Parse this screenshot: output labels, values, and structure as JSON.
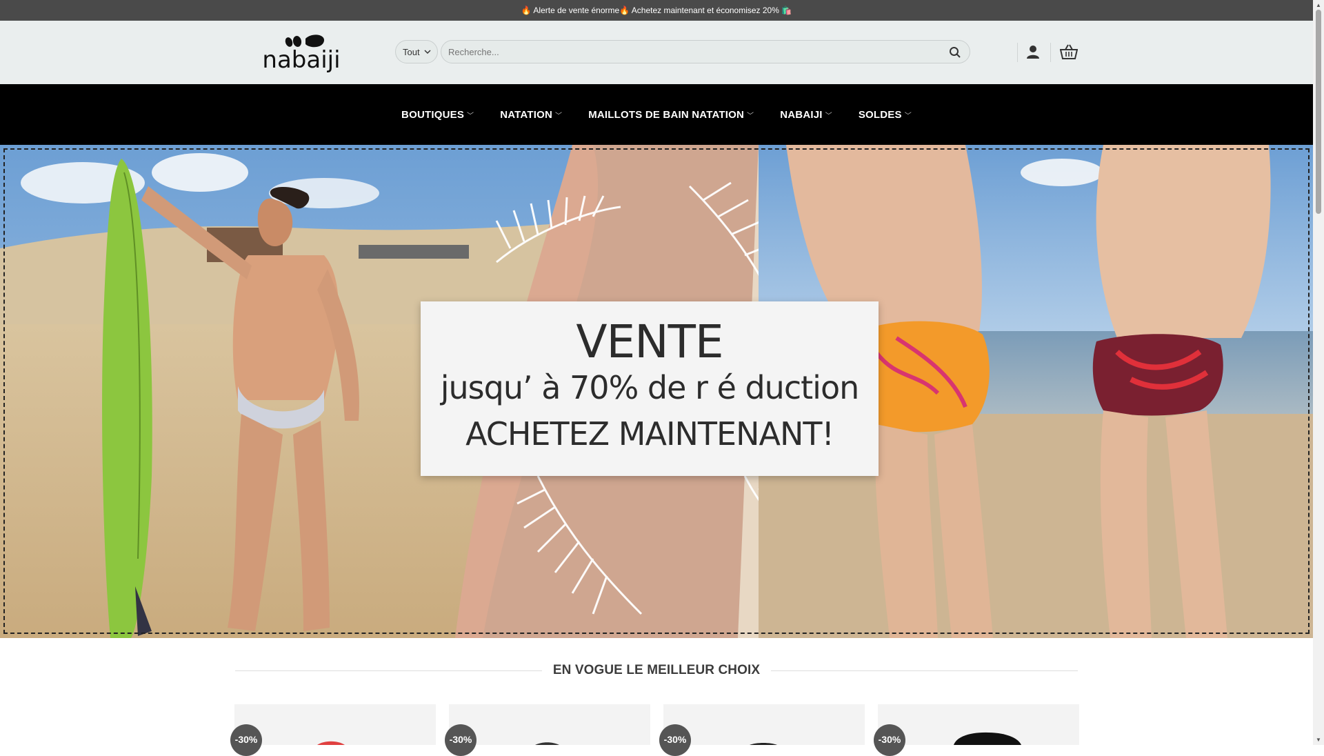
{
  "topbar": {
    "announcement": "🔥 Alerte de vente énorme🔥 Achetez maintenant et économisez 20% 🛍️"
  },
  "header": {
    "logo_text": "nabaiji",
    "category_select": "Tout",
    "search_placeholder": "Recherche...",
    "icons": [
      "search-icon",
      "user-icon",
      "cart-icon"
    ]
  },
  "nav": {
    "items": [
      {
        "label": "BOUTIQUES"
      },
      {
        "label": "NATATION"
      },
      {
        "label": "MAILLOTS DE BAIN NATATION"
      },
      {
        "label": "NABAIJI"
      },
      {
        "label": "SOLDES"
      }
    ]
  },
  "hero": {
    "line1": "VENTE",
    "line2": "jusqu’ à  70% de r é duction",
    "line3": "ACHETEZ MAINTENANT!"
  },
  "section": {
    "title": "EN VOGUE LE MEILLEUR CHOIX"
  },
  "products": [
    {
      "badge": "-30%"
    },
    {
      "badge": "-30%"
    },
    {
      "badge": "-30%"
    },
    {
      "badge": "-30%"
    }
  ],
  "colors": {
    "topbar": "#4a4a4a",
    "header": "#eaeeee",
    "nav": "#000000",
    "badge": "#555555"
  }
}
